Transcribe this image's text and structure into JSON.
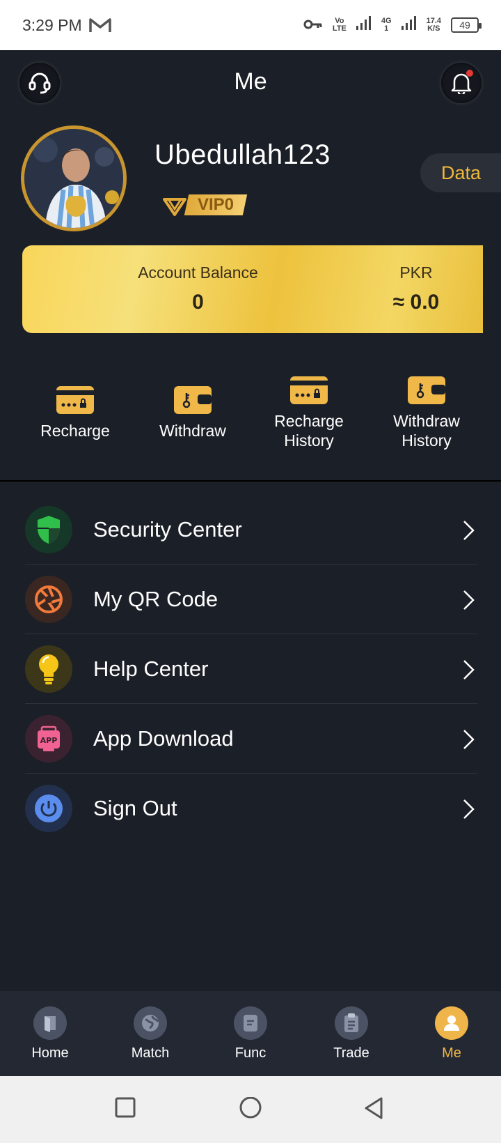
{
  "status_bar": {
    "time": "3:29 PM",
    "net_vo": "Vo",
    "net_lte": "LTE",
    "net_4g": "4G",
    "net_4g_sub": "1",
    "speed_value": "17.4",
    "speed_unit": "K/S",
    "battery": "49"
  },
  "header": {
    "title": "Me"
  },
  "profile": {
    "username": "Ubedullah123",
    "vip_level": "VIP0",
    "data_button": "Data"
  },
  "balance": {
    "account_label": "Account Balance",
    "account_value": "0",
    "currency_label": "PKR",
    "currency_value": "≈ 0.0"
  },
  "actions": [
    {
      "line1": "Recharge",
      "line2": ""
    },
    {
      "line1": "Withdraw",
      "line2": ""
    },
    {
      "line1": "Recharge",
      "line2": "History"
    },
    {
      "line1": "Withdraw",
      "line2": "History"
    }
  ],
  "menu": [
    {
      "label": "Security Center",
      "icon": "shield-icon",
      "color": "#2fbf4a"
    },
    {
      "label": "My QR Code",
      "icon": "aperture-icon",
      "color": "#f27a3a"
    },
    {
      "label": "Help Center",
      "icon": "lightbulb-icon",
      "color": "#f5c518"
    },
    {
      "label": "App Download",
      "icon": "app-icon",
      "color": "#f06292",
      "icon_text": "APP"
    },
    {
      "label": "Sign Out",
      "icon": "power-icon",
      "color": "#5b8def"
    }
  ],
  "bottom_nav": [
    {
      "label": "Home",
      "icon": "home-icon"
    },
    {
      "label": "Match",
      "icon": "globe-icon"
    },
    {
      "label": "Func",
      "icon": "func-icon"
    },
    {
      "label": "Trade",
      "icon": "clipboard-icon"
    },
    {
      "label": "Me",
      "icon": "user-icon",
      "active": true
    }
  ],
  "colors": {
    "accent_gold": "#f0b54a",
    "background": "#1b1f27",
    "nav_background": "#232833"
  }
}
